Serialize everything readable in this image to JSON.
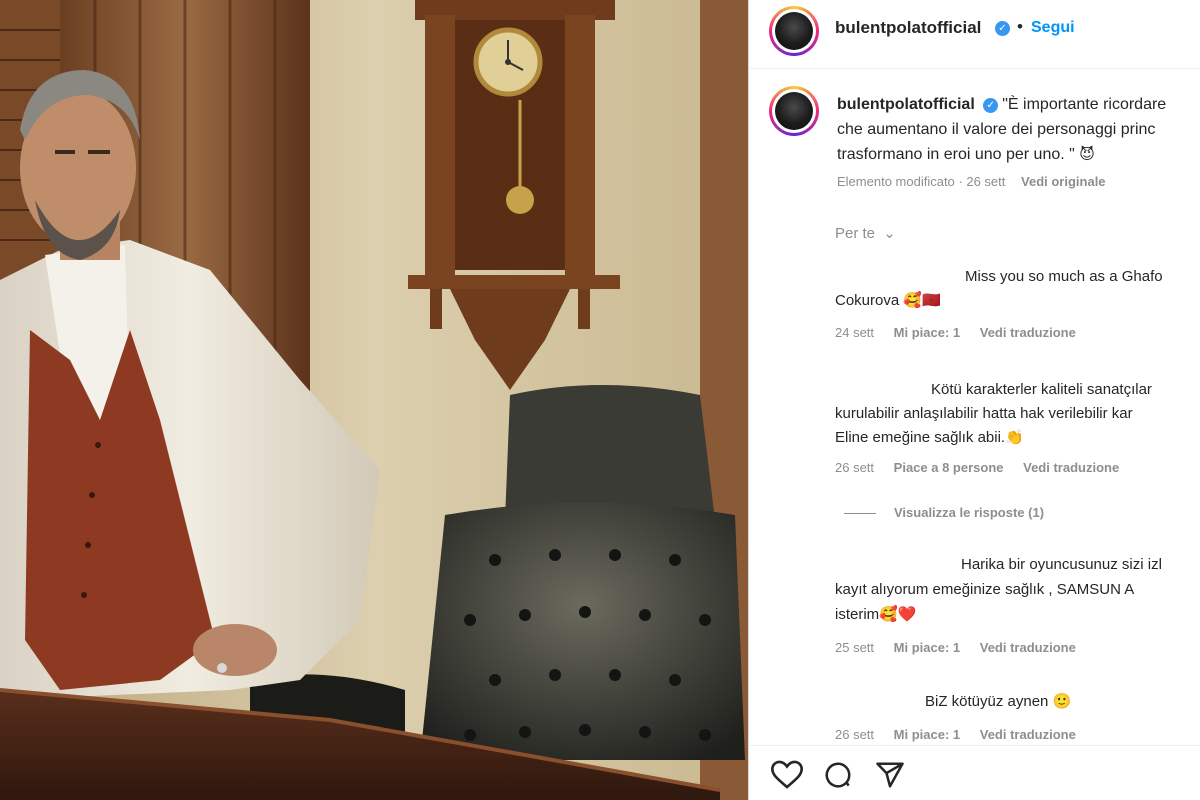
{
  "post": {
    "username": "bulentpolatofficial",
    "follow_label": "Segui",
    "separator": "•"
  },
  "caption": {
    "username": "bulentpolatofficial",
    "line1": "\"È importante ricordare",
    "line2": "che aumentano il valore dei personaggi princ",
    "line3": "trasformano in eroi uno per uno. \"",
    "line3_emoji": "😈",
    "edited": "Elemento modificato",
    "age": "26 sett",
    "see_original": "Vedi originale"
  },
  "filter_label": "Per te",
  "comments": [
    {
      "line1": "Miss you so much as a Ghafo",
      "line2": "Cokurova",
      "emoji": "🥰🇲🇦",
      "age": "24 sett",
      "likes": "Mi piace: 1",
      "translate": "Vedi traduzione"
    },
    {
      "line1": "Kötü karakterler kaliteli sanatçılar",
      "line2": "kurulabilir anlaşılabilir hatta hak verilebilir kar",
      "line3": "Eline emeğine sağlık abii.",
      "emoji": "👏",
      "age": "26 sett",
      "likes": "Piace a 8 persone",
      "translate": "Vedi traduzione",
      "replies": "Visualizza le risposte (1)"
    },
    {
      "line1": "Harika bir oyuncusunuz sizi izl",
      "line2": "kayıt alıyorum emeğinize sağlık , SAMSUN A",
      "line3": "isterim",
      "emoji": "🥰❤️",
      "age": "25 sett",
      "likes": "Mi piace: 1",
      "translate": "Vedi traduzione"
    },
    {
      "line1": "BiZ kötüyüz aynen",
      "emoji": "🙂",
      "age": "26 sett",
      "likes": "Mi piace: 1",
      "translate": "Vedi traduzione"
    }
  ],
  "actions": {
    "like_icon": "heart-icon",
    "comment_icon": "comment-icon",
    "share_icon": "share-icon"
  },
  "colors": {
    "accent": "#0095f6",
    "verified": "#3897f0",
    "text": "#262626",
    "muted": "#8e8e8e",
    "heart": "#ed4956"
  }
}
